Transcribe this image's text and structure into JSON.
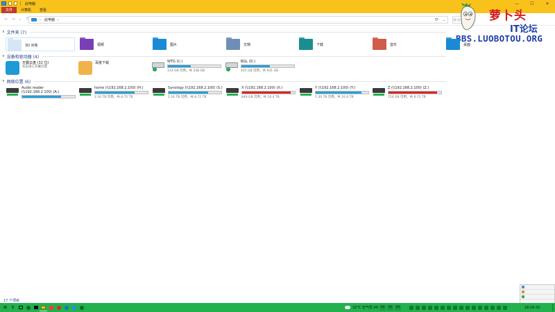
{
  "window": {
    "title": "此电脑",
    "controls": {
      "minimize": "—",
      "maximize": "☐",
      "close": "✕"
    }
  },
  "ribbon": {
    "tabs": [
      "文件",
      "计算机",
      "查看"
    ]
  },
  "address": {
    "back": "←",
    "forward": "→",
    "dropdown": "⌄",
    "up": "↑",
    "separator": "›",
    "path": "此电脑",
    "chevron": "›",
    "refresh_icon": "⟳",
    "search_placeholder": "搜\"此电脑\""
  },
  "watermark": {
    "name_cn": "萝卜头",
    "suffix": "IT论坛",
    "url": "BBS.LUOBOTOU.ORG"
  },
  "sections": {
    "folders": {
      "chevron": "∨",
      "title": "文件夹 (7)",
      "items": [
        {
          "label": "3D 对象",
          "color": "#d6e6f5"
        },
        {
          "label": "视频",
          "color": "#7b3fb5"
        },
        {
          "label": "图片",
          "color": "#1a8ad4"
        },
        {
          "label": "文档",
          "color": "#6d8fb5"
        },
        {
          "label": "下载",
          "color": "#1a8e8e"
        },
        {
          "label": "音乐",
          "color": "#d05c4a"
        },
        {
          "label": "桌面",
          "color": "#1a8ad4"
        }
      ]
    },
    "devices": {
      "chevron": "∨",
      "title": "设备和驱动器 (4)",
      "cloud": {
        "name": "天翼云盘 (32 位)",
        "sub": "双击进入天翼云盘",
        "color": "#1e9ad6"
      },
      "baidu": {
        "name": "百度下载",
        "color": "#f2b24a"
      },
      "drives": [
        {
          "name": "WTG (C:)",
          "used_fraction": 0.44,
          "free": "133 GB 可用，共 238 GB",
          "check": "✓"
        },
        {
          "name": "BGL (D:)",
          "used_fraction": 0.54,
          "free": "425 GB 可用，共 931 GB",
          "check": "✓"
        }
      ]
    },
    "network": {
      "chevron": "∨",
      "title": "网络位置 (6)",
      "items": [
        {
          "name": "Audio reader (\\\\192.168.2.100) (A:)",
          "free": "",
          "used_fraction": 0.74,
          "full": false
        },
        {
          "name": "home (\\\\192.168.2.100) (H:)",
          "free": "2.16 TB 可用，共 8.72 TB",
          "used_fraction": 0.75,
          "full": false
        },
        {
          "name": "Synology (\\\\192.168.2.100) (S:)",
          "free": "2.16 TB 可用，共 8.72 TB",
          "used_fraction": 0.75,
          "full": false
        },
        {
          "name": "X (\\\\192.168.2.100) (X:)",
          "free": "849 GB 可用，共 10.4 TB",
          "used_fraction": 0.92,
          "full": true
        },
        {
          "name": "Y (\\\\192.168.2.100) (Y:)",
          "free": "1.30 TB 可用，共 10.4 TB",
          "used_fraction": 0.87,
          "full": false
        },
        {
          "name": "Z (\\\\192.168.2.100) (Z:)",
          "free": "724 GB 可用，共 8.72 TB",
          "used_fraction": 0.92,
          "full": true
        }
      ]
    }
  },
  "status": {
    "count": "17 个项目"
  },
  "taskbar": {
    "start_icon": "⊞",
    "search_icon": "⚲",
    "weather": "32°C 空气优 49",
    "numbers": [
      "33",
      "35",
      "33"
    ],
    "clock": "18:26:32",
    "accent": "#23b14d"
  }
}
